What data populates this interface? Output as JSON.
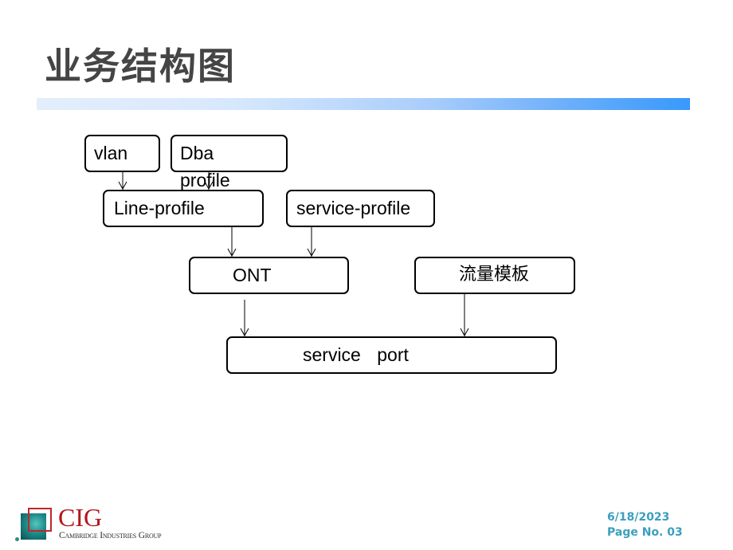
{
  "slide": {
    "title": "业务结构图",
    "accent_bar_colors": [
      "#e2eefc",
      "#3899fb"
    ]
  },
  "diagram": {
    "nodes": {
      "vlan": "vlan",
      "dba_profile": "Dba profile",
      "line_profile": "Line-profile",
      "service_profile": "service-profile",
      "ont": "ONT",
      "traffic_template": "流量模板",
      "service_port": "service port"
    },
    "edges": [
      {
        "from": "vlan",
        "to": "line_profile"
      },
      {
        "from": "dba_profile",
        "to": "line_profile"
      },
      {
        "from": "line_profile",
        "to": "ont"
      },
      {
        "from": "service_profile",
        "to": "ont"
      },
      {
        "from": "ont",
        "to": "service_port"
      },
      {
        "from": "traffic_template",
        "to": "service_port"
      }
    ]
  },
  "footer": {
    "logo_text": "CIG",
    "logo_subtitle": "Cambridge Industries Group",
    "date": "6/18/2023",
    "page": "Page No. 03"
  }
}
